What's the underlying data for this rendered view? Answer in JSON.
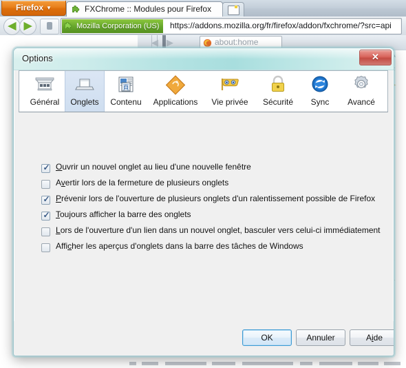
{
  "browser": {
    "app_button_label": "Firefox",
    "tab_title": "FXChrome :: Modules pour Firefox",
    "identity_label": "Mozilla Corporation (US)",
    "url": "https://addons.mozilla.org/fr/firefox/addon/fxchrome/?src=api",
    "background_page_label": "about:home"
  },
  "dialog": {
    "title": "Options",
    "close_glyph": "✕",
    "categories": [
      {
        "label": "Général",
        "icon": "general-icon",
        "selected": false
      },
      {
        "label": "Onglets",
        "icon": "tabs-icon",
        "selected": true
      },
      {
        "label": "Contenu",
        "icon": "content-icon",
        "selected": false
      },
      {
        "label": "Applications",
        "icon": "applications-icon",
        "selected": false
      },
      {
        "label": "Vie privée",
        "icon": "privacy-mask-icon",
        "selected": false
      },
      {
        "label": "Sécurité",
        "icon": "security-lock-icon",
        "selected": false
      },
      {
        "label": "Sync",
        "icon": "sync-icon",
        "selected": false
      },
      {
        "label": "Avancé",
        "icon": "advanced-gear-icon",
        "selected": false
      }
    ],
    "options": [
      {
        "checked": true,
        "accel": "O",
        "before": "",
        "after": "uvrir un nouvel onglet au lieu d'une nouvelle fenêtre",
        "full_text": "Ouvrir un nouvel onglet au lieu d'une nouvelle fenêtre"
      },
      {
        "checked": false,
        "accel": "v",
        "before": "A",
        "after": "ertir lors de la fermeture de plusieurs onglets",
        "full_text": "Avertir lors de la fermeture de plusieurs onglets"
      },
      {
        "checked": true,
        "accel": "P",
        "before": "",
        "after": "révenir lors de l'ouverture de plusieurs onglets d'un ralentissement possible de Firefox",
        "full_text": "Prévenir lors de l'ouverture de plusieurs onglets d'un ralentissement possible de Firefox"
      },
      {
        "checked": true,
        "accel": "T",
        "before": "",
        "after": "oujours afficher la barre des onglets",
        "full_text": "Toujours afficher la barre des onglets"
      },
      {
        "checked": false,
        "accel": "L",
        "before": "",
        "after": "ors de l'ouverture d'un lien dans un nouvel onglet, basculer vers celui-ci immédiatement",
        "full_text": "Lors de l'ouverture d'un lien dans un nouvel onglet, basculer vers celui-ci immédiatement"
      },
      {
        "checked": false,
        "accel": "c",
        "before": "Affi",
        "after": "her les aperçus d'onglets dans la barre des tâches de Windows",
        "full_text": "Afficher les aperçus d'onglets dans la barre des tâches de Windows"
      }
    ],
    "buttons": {
      "ok": {
        "label": "OK",
        "accel": "",
        "default": true
      },
      "cancel": {
        "label": "Annuler",
        "accel": "",
        "default": false
      },
      "help": {
        "before": "A",
        "accel": "i",
        "after": "de",
        "label": "Aide",
        "default": false
      }
    }
  },
  "colors": {
    "title_bar_glass": "#b3e2e2",
    "selected_tab_blue": "#cfdef0",
    "firefox_orange": "#e8801c",
    "identity_green": "#64a52a",
    "close_red": "#c44c43",
    "default_button_border": "#3c9ad4"
  }
}
